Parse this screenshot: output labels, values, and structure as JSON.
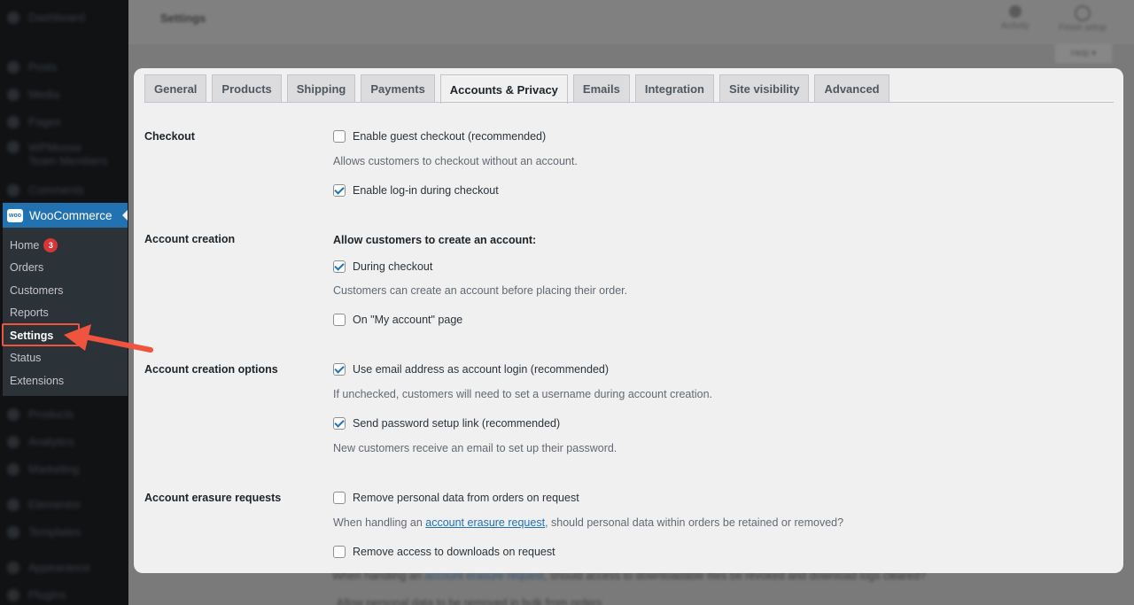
{
  "header": {
    "page_title": "Settings",
    "activity_label": "Activity",
    "finish_setup_label": "Finish setup",
    "help_label": "Help ▾"
  },
  "sidebar": {
    "top_items": [
      {
        "label": "Dashboard",
        "icon": "dashboard-icon"
      },
      {
        "label": "Posts",
        "icon": "pin-icon"
      },
      {
        "label": "Media",
        "icon": "media-icon"
      },
      {
        "label": "Pages",
        "icon": "page-icon"
      },
      {
        "label": "WPMoose Team Members",
        "icon": "team-icon"
      },
      {
        "label": "Comments",
        "icon": "comment-icon"
      }
    ],
    "woocommerce": {
      "label": "WooCommerce",
      "logo_text": "woo",
      "submenu": [
        {
          "label": "Home",
          "badge": "3"
        },
        {
          "label": "Orders"
        },
        {
          "label": "Customers"
        },
        {
          "label": "Reports"
        },
        {
          "label": "Settings",
          "active": true
        },
        {
          "label": "Status"
        },
        {
          "label": "Extensions"
        }
      ]
    },
    "bottom_items": [
      {
        "label": "Products",
        "icon": "products-icon"
      },
      {
        "label": "Analytics",
        "icon": "analytics-icon"
      },
      {
        "label": "Marketing",
        "icon": "marketing-icon"
      },
      {
        "label": "Elementor",
        "icon": "elementor-icon"
      },
      {
        "label": "Templates",
        "icon": "templates-icon"
      },
      {
        "label": "Appearance",
        "icon": "appearance-icon"
      },
      {
        "label": "Plugins",
        "icon": "plugins-icon"
      }
    ]
  },
  "tabs": [
    {
      "label": "General"
    },
    {
      "label": "Products"
    },
    {
      "label": "Shipping"
    },
    {
      "label": "Payments"
    },
    {
      "label": "Accounts & Privacy",
      "active": true
    },
    {
      "label": "Emails"
    },
    {
      "label": "Integration"
    },
    {
      "label": "Site visibility"
    },
    {
      "label": "Advanced"
    }
  ],
  "sections": {
    "checkout": {
      "label": "Checkout",
      "guest_checkout": {
        "label": "Enable guest checkout (recommended)",
        "checked": false
      },
      "guest_desc": "Allows customers to checkout without an account.",
      "login_checkout": {
        "label": "Enable log-in during checkout",
        "checked": true
      }
    },
    "account_creation": {
      "label": "Account creation",
      "subheading": "Allow customers to create an account:",
      "during_checkout": {
        "label": "During checkout",
        "checked": true
      },
      "during_checkout_desc": "Customers can create an account before placing their order.",
      "my_account": {
        "label": "On \"My account\" page",
        "checked": false
      }
    },
    "account_creation_options": {
      "label": "Account creation options",
      "email_login": {
        "label": "Use email address as account login (recommended)",
        "checked": true
      },
      "email_login_desc": "If unchecked, customers will need to set a username during account creation.",
      "password_link": {
        "label": "Send password setup link (recommended)",
        "checked": true
      },
      "password_link_desc": "New customers receive an email to set up their password."
    },
    "erasure": {
      "label": "Account erasure requests",
      "remove_personal": {
        "label": "Remove personal data from orders on request",
        "checked": false
      },
      "desc_prefix": "When handling an ",
      "desc_link": "account erasure request",
      "desc_suffix": ", should personal data within orders be retained or removed?",
      "remove_downloads": {
        "label": "Remove access to downloads on request",
        "checked": false
      },
      "downloads_desc_prefix": "When handling an ",
      "downloads_desc_link": "account erasure request",
      "downloads_desc_suffix": ", should access to downloadable files be revoked and download logs cleared?",
      "next_option": "Allow personal data to be removed in bulk from orders"
    }
  },
  "colors": {
    "accent": "#2271b1",
    "annotation": "#f0533e",
    "badge": "#d63638"
  }
}
